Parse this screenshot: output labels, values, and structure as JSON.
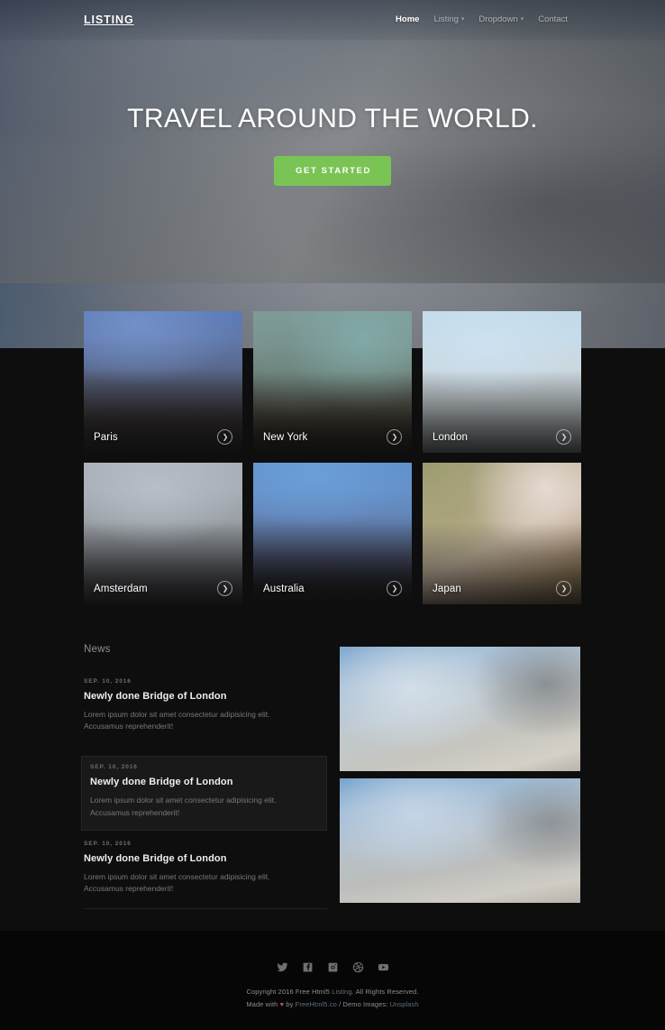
{
  "header": {
    "logo": "LISTING",
    "nav": [
      {
        "label": "Home",
        "active": true,
        "caret": false
      },
      {
        "label": "Listing",
        "active": false,
        "caret": true
      },
      {
        "label": "Dropdown",
        "active": false,
        "caret": true
      },
      {
        "label": "Contact",
        "active": false,
        "caret": false
      }
    ]
  },
  "hero": {
    "title": "TRAVEL AROUND THE WORLD.",
    "cta_label": "GET STARTED",
    "cta_color": "#7ac455"
  },
  "destinations": [
    {
      "name": "Paris",
      "go_icon": "chevron-right-icon"
    },
    {
      "name": "New York",
      "go_icon": "chevron-right-icon"
    },
    {
      "name": "London",
      "go_icon": "chevron-right-icon"
    },
    {
      "name": "Amsterdam",
      "go_icon": "chevron-right-icon"
    },
    {
      "name": "Australia",
      "go_icon": "chevron-right-icon"
    },
    {
      "name": "Japan",
      "go_icon": "chevron-right-icon"
    }
  ],
  "news": {
    "heading": "News",
    "items": [
      {
        "date": "SEP. 10, 2016",
        "title": "Newly done Bridge of London",
        "excerpt": "Lorem ipsum dolor sit amet consectetur adipisicing elit. Accusamus reprehenderit!"
      },
      {
        "date": "SEP. 10, 2016",
        "title": "Newly done Bridge of London",
        "excerpt": "Lorem ipsum dolor sit amet consectetur adipisicing elit. Accusamus reprehenderit!"
      },
      {
        "date": "SEP. 10, 2016",
        "title": "Newly done Bridge of London",
        "excerpt": "Lorem ipsum dolor sit amet consectetur adipisicing elit. Accusamus reprehenderit!"
      }
    ]
  },
  "footer": {
    "socials": [
      {
        "name": "twitter-icon"
      },
      {
        "name": "facebook-icon"
      },
      {
        "name": "instagram-icon"
      },
      {
        "name": "dribbble-icon"
      },
      {
        "name": "youtube-icon"
      }
    ],
    "copyright_pre": "Copyright 2016 Free Html5 ",
    "copyright_link": "Listing",
    "copyright_post": ". All Rights Reserved.",
    "made_pre": "Made with ",
    "made_heart": "♥",
    "made_by": " by ",
    "made_link": "FreeHtml5.co",
    "made_sep": " / Demo Images: ",
    "made_link2": "Unsplash"
  }
}
